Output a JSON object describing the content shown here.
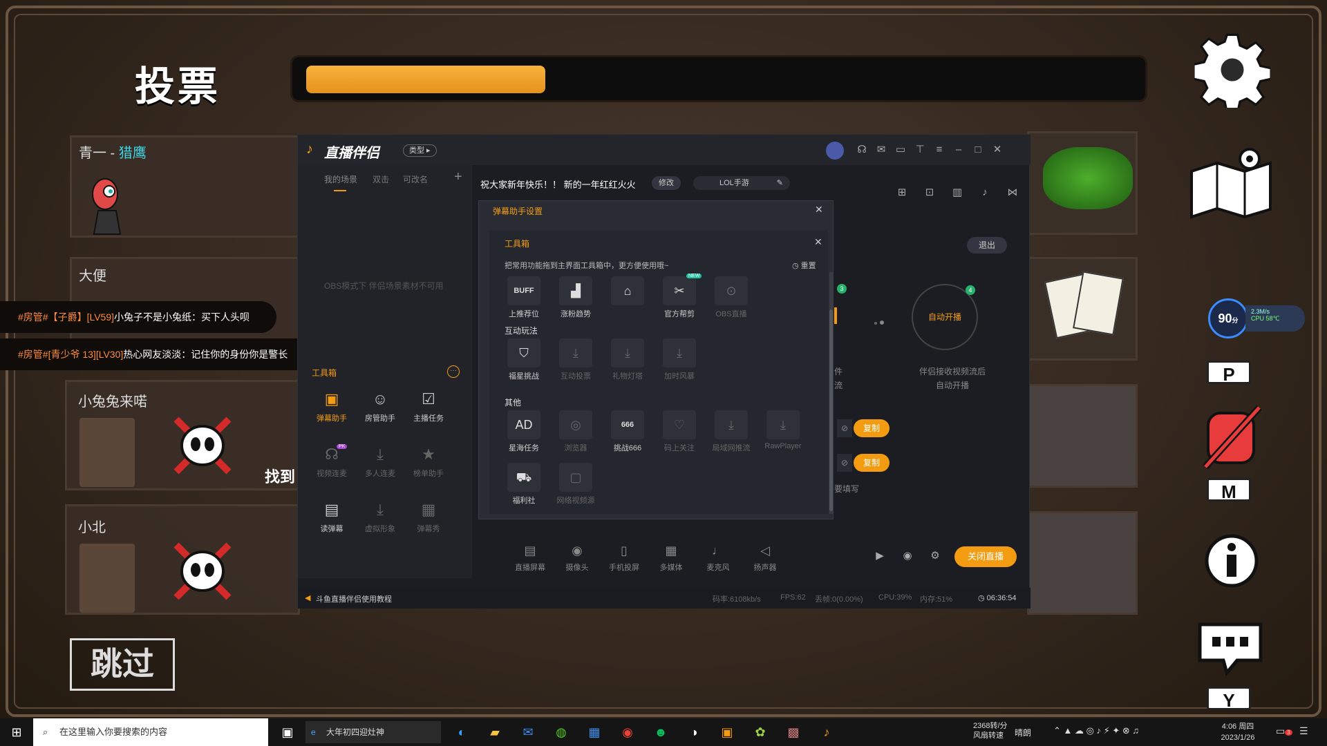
{
  "game": {
    "vote_title": "投票",
    "vote_progress": 0.29,
    "skip_label": "跳过",
    "found_text": "找到",
    "players": [
      {
        "name_prefix": "青一 - ",
        "role": "猎鹰",
        "role_color": "#3fd4e4"
      },
      {
        "name": "大便"
      },
      {
        "name": "小兔兔来喏"
      },
      {
        "name": "小北"
      }
    ],
    "keys": [
      "P",
      "M",
      "Y"
    ],
    "perf_badge": {
      "value": "90",
      "unit": "分",
      "net": "2.3M/s",
      "cpu": "CPU 58℃"
    }
  },
  "chat": [
    {
      "tag": "#房管#【子爵】[LV59]",
      "text": "小兔子不是小兔纸：买下人头呗"
    },
    {
      "tag": "#房管#[青少爷 13][LV30]",
      "text": "热心网友淡淡：记住你的身份你是警长"
    }
  ],
  "app": {
    "title": "直播伴侣",
    "mode_badge": "类型 ▸",
    "tabs": [
      "我的场景",
      "双击",
      "可改名"
    ],
    "obs_notice": "OBS模式下 伴侣场景素材不可用",
    "toolbox_title": "工具箱",
    "announcement": "祝大家新年快乐！！ 新的一年红红火火",
    "edit_label": "修改",
    "game_tag": "LOL手游",
    "exit_label": "退出",
    "tools": [
      {
        "label": "弹幕助手",
        "icon": "▣",
        "active": true
      },
      {
        "label": "房管助手",
        "icon": "☺",
        "active": false
      },
      {
        "label": "主播任务",
        "icon": "☑",
        "active": false
      },
      {
        "label": "视频连麦",
        "icon": "☊",
        "active": false,
        "muted": true,
        "badge": "PK"
      },
      {
        "label": "多人连麦",
        "icon": "⤓",
        "active": false,
        "muted": true
      },
      {
        "label": "榜单助手",
        "icon": "★",
        "active": false,
        "muted": true
      },
      {
        "label": "读弹幕",
        "icon": "▤",
        "active": false
      },
      {
        "label": "虚拟形象",
        "icon": "⤓",
        "active": false,
        "muted": true
      },
      {
        "label": "弹幕秀",
        "icon": "▦",
        "active": false,
        "muted": true
      }
    ],
    "dialog": {
      "title": "弹幕助手设置",
      "inner_title": "工具箱",
      "hint": "把常用功能拖到主界面工具箱中，更方便使用哦~",
      "reset_label": "重置",
      "top_row": [
        {
          "label": "上推荐位",
          "icon": "BUFF"
        },
        {
          "label": "涨粉趋势",
          "icon": "▟"
        },
        {
          "label": "",
          "icon": "⌂"
        },
        {
          "label": "官方帮剪",
          "icon": "✂",
          "badge": "NEW"
        },
        {
          "label": "OBS直播",
          "icon": "⊙",
          "off": true
        }
      ],
      "sections": [
        {
          "title": "互动玩法",
          "items": [
            {
              "label": "福星挑战",
              "icon": "⛉"
            },
            {
              "label": "互动投票",
              "icon": "⤓",
              "off": true
            },
            {
              "label": "礼物灯塔",
              "icon": "⤓",
              "off": true
            },
            {
              "label": "加时风暴",
              "icon": "⤓",
              "off": true
            }
          ]
        },
        {
          "title": "其他",
          "items": [
            {
              "label": "星海任务",
              "icon": "AD"
            },
            {
              "label": "浏览器",
              "icon": "◎",
              "off": true
            },
            {
              "label": "挑战666",
              "icon": "666"
            },
            {
              "label": "码上关注",
              "icon": "♡",
              "off": true
            },
            {
              "label": "局域网推流",
              "icon": "⤓",
              "off": true
            },
            {
              "label": "RawPlayer",
              "icon": "⤓",
              "off": true
            },
            {
              "label": "福利社",
              "icon": "⛟"
            },
            {
              "label": "网络视频源",
              "icon": "▢",
              "off": true
            }
          ]
        }
      ]
    },
    "right_panel": {
      "auto_open": "自动开播",
      "auto_desc1": "伴侣接收视频流后",
      "auto_desc2": "自动开播",
      "step3": "3",
      "step4": "4",
      "copy_label": "复制",
      "partial1": "件",
      "partial2": "流",
      "fill_hint": "要填写"
    },
    "bottom_tools": [
      "直播屏幕",
      "摄像头",
      "手机投屏",
      "多媒体",
      "麦克风",
      "扬声器"
    ],
    "close_live": "关闭直播",
    "status": {
      "tutorial": "斗鱼直播伴侣使用教程",
      "bitrate": "码率:6108kb/s",
      "fps": "FPS:62",
      "dropped": "丢帧:0(0.00%)",
      "cpu": "CPU:39%",
      "mem": "内存:51%",
      "time": "06:36:54"
    }
  },
  "taskbar": {
    "search_placeholder": "在这里输入你要搜索的内容",
    "browser_tab": "大年初四迎灶神",
    "weather": "2368转/分",
    "weather2": "风扇转速",
    "weather_desc": "晴朗",
    "time": "4:06 周四",
    "date": "2023/1/26",
    "notif_count": "3"
  }
}
